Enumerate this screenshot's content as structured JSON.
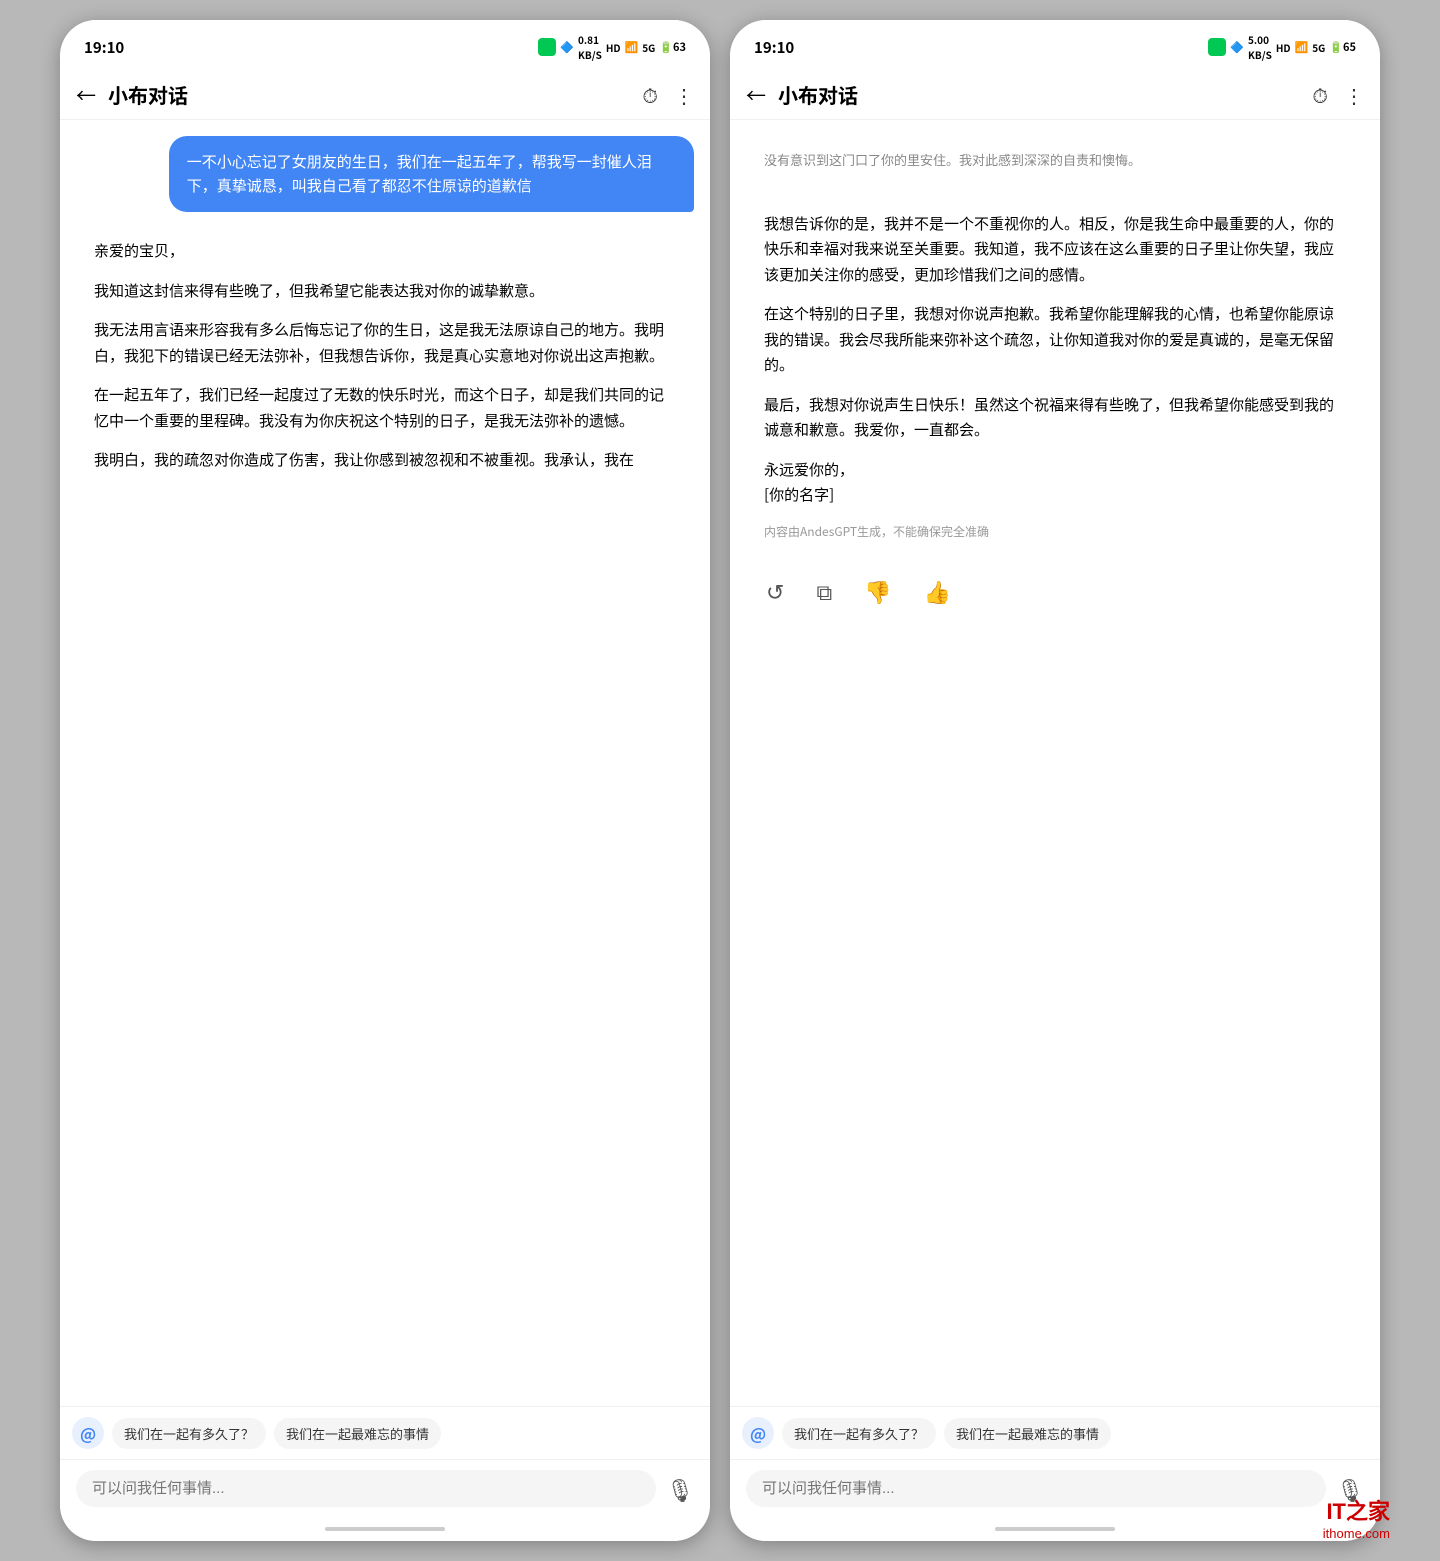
{
  "app": {
    "name": "小布对话",
    "time": "19:10",
    "back_label": "←",
    "history_icon": "⏱",
    "more_icon": "⋮"
  },
  "phone_left": {
    "status": {
      "time": "19:10",
      "kb_label": "0.81\nKB/S"
    },
    "user_message": "一不小心忘记了女朋友的生日，我们在一起五年了，帮我写一封催人泪下，真挚诚恳，叫我自己看了都忍不住原谅的道歉信",
    "ai_message_paragraphs": [
      "亲爱的宝贝，",
      "我知道这封信来得有些晚了，但我希望它能表达我对你的诚挚歉意。",
      "我无法用言语来形容我有多么后悔忘记了你的生日，这是我无法原谅自己的地方。我明白，我犯下的错误已经无法弥补，但我想告诉你，我是真心实意地对你说出这声抱歉。",
      "在一起五年了，我们已经一起度过了无数的快乐时光，而这个日子，却是我们共同的记忆中一个重要的里程碑。我没有为你庆祝这个特别的日子，是我无法弥补的遗憾。",
      "我明白，我的疏忽对你造成了伤害，我让你感到被忽视和不被重视。我承认，我在"
    ],
    "suggestions": [
      "我们在一起有多久了？",
      "我们在一起最难忘的事情"
    ],
    "input_placeholder": "可以问我任何事情..."
  },
  "phone_right": {
    "status": {
      "time": "19:10",
      "kb_label": "5.00\nKB/S"
    },
    "partial_top": "没有意识到这门口了你的里安住。我对此感到深深的自责和懊悔。",
    "ai_message_paragraphs": [
      "我想告诉你的是，我并不是一个不重视你的人。相反，你是我生命中最重要的人，你的快乐和幸福对我来说至关重要。我知道，我不应该在这么重要的日子里让你失望，我应该更加关注你的感受，更加珍惜我们之间的感情。",
      "在这个特别的日子里，我想对你说声抱歉。我希望你能理解我的心情，也希望你能原谅我的错误。我会尽我所能来弥补这个疏忽，让你知道我对你的爱是真诚的，是毫无保留的。",
      "最后，我想对你说声生日快乐！虽然这个祝福来得有些晚了，但我希望你能感受到我的诚意和歉意。我爱你，一直都会。",
      "永远爱你的，\n[你的名字]"
    ],
    "disclaimer": "内容由AndesGPT生成，不能确保完全准确",
    "action_buttons": [
      "↺",
      "⧉",
      "👎",
      "👍"
    ],
    "suggestions": [
      "我们在一起有多久了？",
      "我们在一起最难忘的事情"
    ],
    "input_placeholder": "可以问我任何事情..."
  },
  "watermark": "IT之家\nithome.com"
}
